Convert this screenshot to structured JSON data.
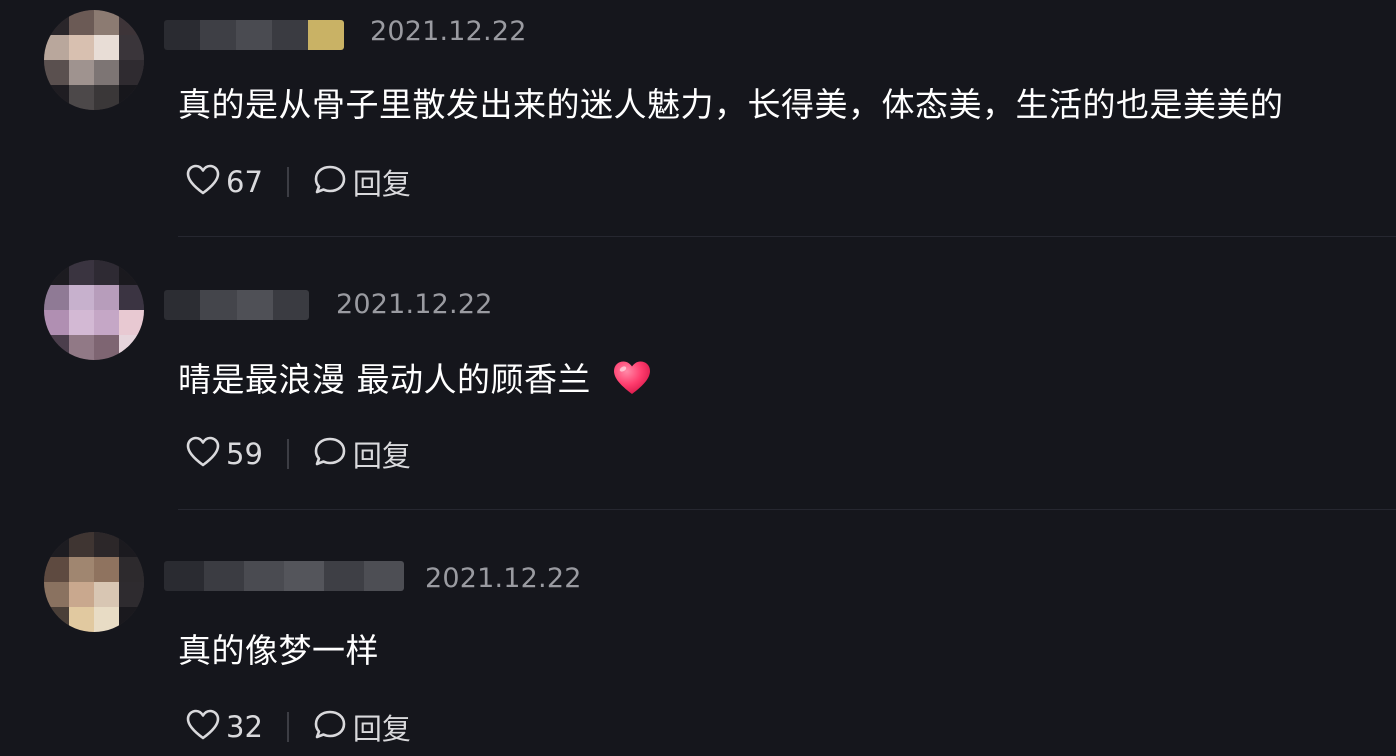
{
  "colors": {
    "background": "#15161c",
    "text": "#ffffff",
    "date": "#9a9ba1",
    "action": "#d9d9dc",
    "heart_emoji": "#ff3d6e"
  },
  "comments": [
    {
      "date": "2021.12.22",
      "text": "真的是从骨子里散发出来的迷人魅力，长得美，体态美，生活的也是美美的",
      "likes": "67",
      "reply_label": "回复",
      "like_icon": "heart-outline-icon",
      "reply_icon": "speech-bubble-icon"
    },
    {
      "date": "2021.12.22",
      "text": "晴是最浪漫 最动人的顾香兰",
      "emoji": "heart-emoji",
      "likes": "59",
      "reply_label": "回复",
      "like_icon": "heart-outline-icon",
      "reply_icon": "speech-bubble-icon"
    },
    {
      "date": "2021.12.22",
      "text": "真的像梦一样",
      "likes": "32",
      "reply_label": "回复",
      "like_icon": "heart-outline-icon",
      "reply_icon": "speech-bubble-icon"
    }
  ]
}
